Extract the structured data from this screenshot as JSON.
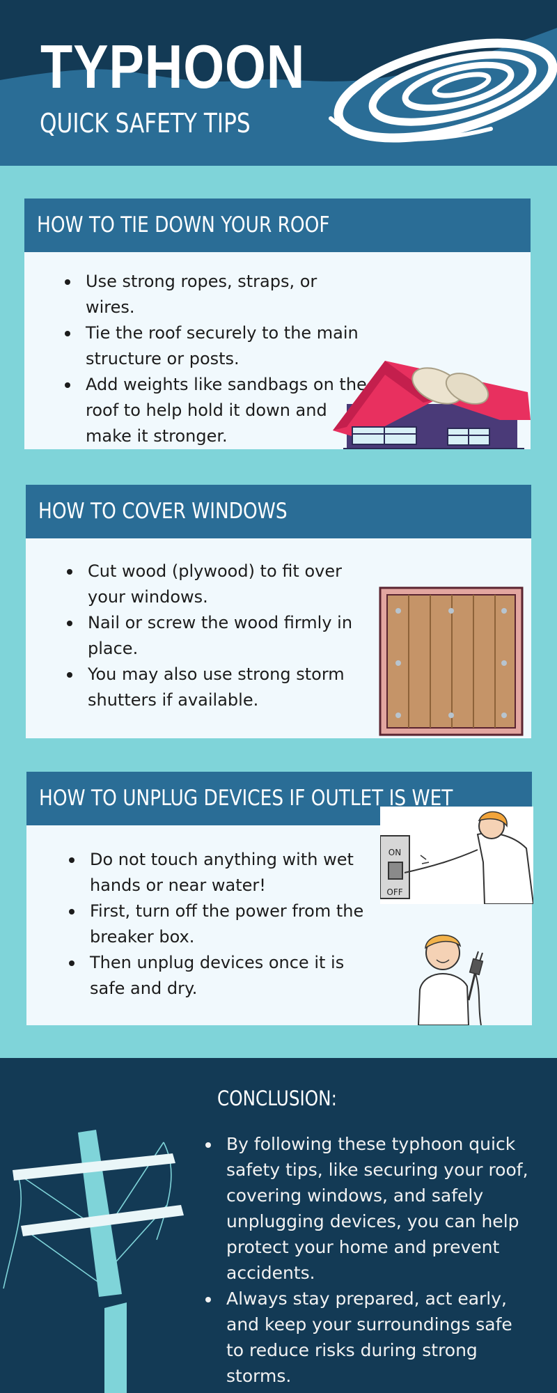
{
  "header": {
    "title": "TYPHOON",
    "subtitle": "QUICK SAFETY TIPS"
  },
  "sections": [
    {
      "heading": "HOW TO TIE DOWN YOUR ROOF",
      "tips": [
        "Use strong ropes, straps, or wires.",
        "Tie the roof securely to the main structure or posts.",
        "Add weights like sandbags on the roof to help hold it down and make it stronger."
      ]
    },
    {
      "heading": "HOW TO COVER WINDOWS",
      "tips": [
        "Cut wood (plywood) to fit over your windows.",
        "Nail or screw the wood firmly in place.",
        "You may also use strong storm shutters if available."
      ]
    },
    {
      "heading": "HOW TO UNPLUG DEVICES IF OUTLET IS WET",
      "tips": [
        "Do not touch anything with wet hands or near water!",
        "First, turn off the power from the breaker box.",
        "Then unplug devices once it is safe and dry."
      ],
      "switch_on": "ON",
      "switch_off": "OFF"
    }
  ],
  "conclusion": {
    "heading": "CONCLUSION:",
    "points": [
      "By following these typhoon quick safety tips, like securing your roof, covering windows, and safely unplugging devices, you can help protect your home and prevent accidents.",
      "Always stay prepared, act early, and keep your surroundings safe to reduce risks during strong storms."
    ]
  },
  "colors": {
    "header_blue": "#2a6d96",
    "header_dark": "#133a55",
    "background_teal": "#7fd4d9",
    "card_bg": "#f1f9fd"
  }
}
